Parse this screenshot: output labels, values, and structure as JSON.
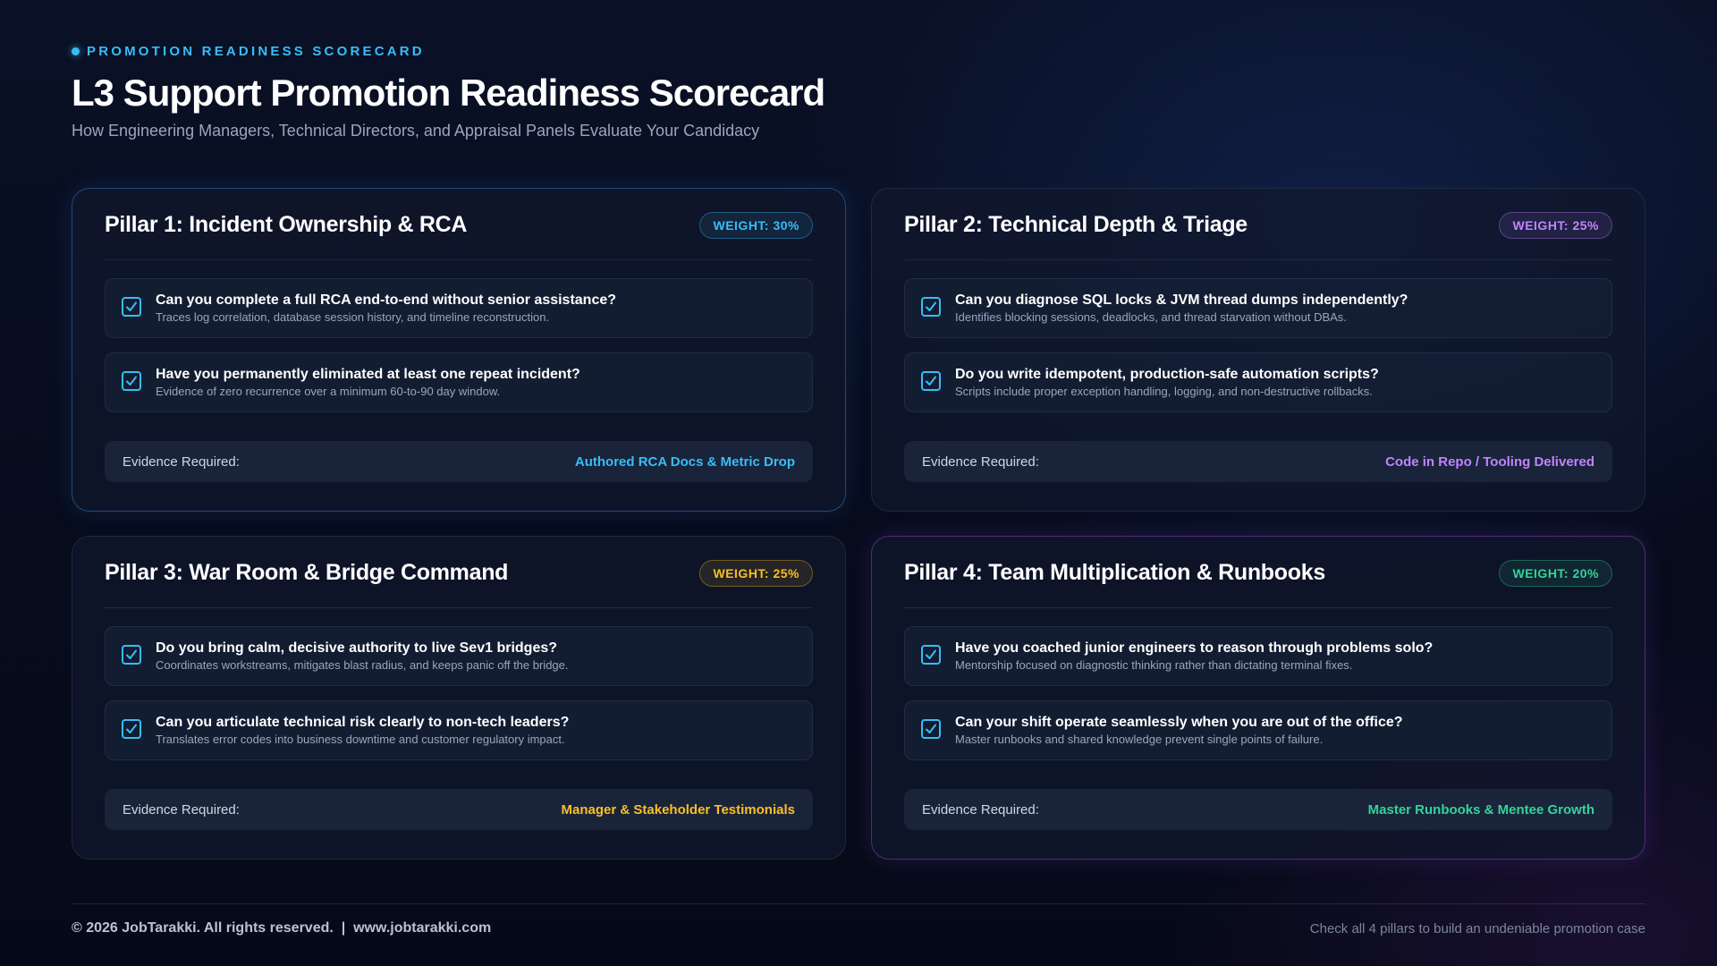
{
  "header": {
    "eyebrow": "PROMOTION READINESS SCORECARD",
    "title": "L3 Support Promotion Readiness Scorecard",
    "subtitle": "How Engineering Managers, Technical Directors, and Appraisal Panels Evaluate Your Candidacy"
  },
  "colors": {
    "blue": "#38bdf8",
    "purple": "#c084fc",
    "amber": "#fbbf24",
    "green": "#34d399"
  },
  "pillars": [
    {
      "title": "Pillar 1: Incident Ownership & RCA",
      "weight": "WEIGHT: 30%",
      "items": [
        {
          "question": "Can you complete a full RCA end-to-end without senior assistance?",
          "detail": "Traces log correlation, database session history, and timeline reconstruction."
        },
        {
          "question": "Have you permanently eliminated at least one repeat incident?",
          "detail": "Evidence of zero recurrence over a minimum 60-to-90 day window."
        }
      ],
      "evidence_label": "Evidence Required:",
      "evidence_value": "Authored RCA Docs & Metric Drop"
    },
    {
      "title": "Pillar 2: Technical Depth & Triage",
      "weight": "WEIGHT: 25%",
      "items": [
        {
          "question": "Can you diagnose SQL locks & JVM thread dumps independently?",
          "detail": "Identifies blocking sessions, deadlocks, and thread starvation without DBAs."
        },
        {
          "question": "Do you write idempotent, production-safe automation scripts?",
          "detail": "Scripts include proper exception handling, logging, and non-destructive rollbacks."
        }
      ],
      "evidence_label": "Evidence Required:",
      "evidence_value": "Code in Repo / Tooling Delivered"
    },
    {
      "title": "Pillar 3: War Room & Bridge Command",
      "weight": "WEIGHT: 25%",
      "items": [
        {
          "question": "Do you bring calm, decisive authority to live Sev1 bridges?",
          "detail": "Coordinates workstreams, mitigates blast radius, and keeps panic off the bridge."
        },
        {
          "question": "Can you articulate technical risk clearly to non-tech leaders?",
          "detail": "Translates error codes into business downtime and customer regulatory impact."
        }
      ],
      "evidence_label": "Evidence Required:",
      "evidence_value": "Manager & Stakeholder Testimonials"
    },
    {
      "title": "Pillar 4: Team Multiplication & Runbooks",
      "weight": "WEIGHT: 20%",
      "items": [
        {
          "question": "Have you coached junior engineers to reason through problems solo?",
          "detail": "Mentorship focused on diagnostic thinking rather than dictating terminal fixes."
        },
        {
          "question": "Can your shift operate seamlessly when you are out of the office?",
          "detail": "Master runbooks and shared knowledge prevent single points of failure."
        }
      ],
      "evidence_label": "Evidence Required:",
      "evidence_value": "Master Runbooks & Mentee Growth"
    }
  ],
  "footer": {
    "left": "© 2026 JobTarakki. All rights reserved.  |  www.jobtarakki.com",
    "right": "Check all 4 pillars to build an undeniable promotion case"
  }
}
